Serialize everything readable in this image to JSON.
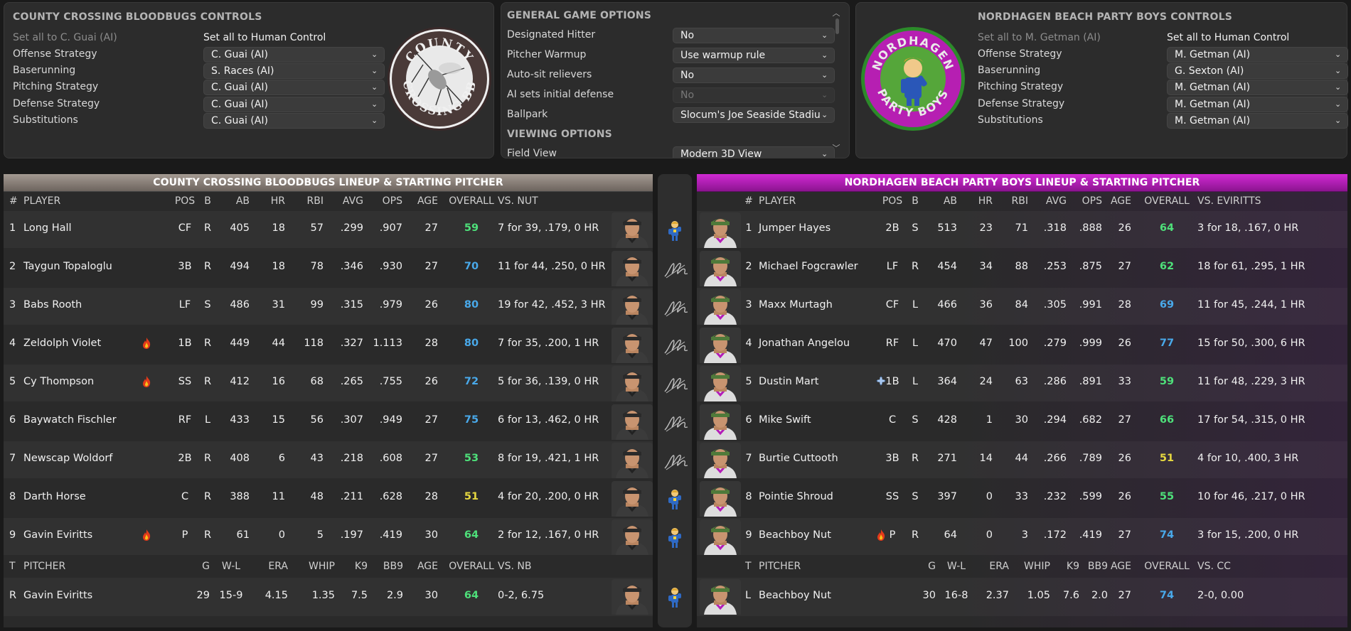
{
  "colors": {
    "away_accent": "#8a8078",
    "home_accent": "#c21bc4",
    "rating_green": "#4ee07a",
    "rating_blue": "#49a9ea",
    "rating_yellow": "#e6d840"
  },
  "away_controls": {
    "title": "COUNTY CROSSING BLOODBUGS CONTROLS",
    "set_ai": "Set all to C. Guai (AI)",
    "set_human": "Set all to Human Control",
    "rows": [
      {
        "label": "Offense Strategy",
        "value": "C. Guai (AI)"
      },
      {
        "label": "Baserunning",
        "value": "S. Races (AI)"
      },
      {
        "label": "Pitching Strategy",
        "value": "C. Guai (AI)"
      },
      {
        "label": "Defense Strategy",
        "value": "C. Guai (AI)"
      },
      {
        "label": "Substitutions",
        "value": "C. Guai (AI)"
      }
    ],
    "logo": {
      "top": "COUNTY",
      "bottom": "CROSSING BB"
    }
  },
  "options": {
    "title": "GENERAL GAME OPTIONS",
    "rows": [
      {
        "label": "Designated Hitter",
        "value": "No"
      },
      {
        "label": "Pitcher Warmup",
        "value": "Use warmup rule"
      },
      {
        "label": "Auto-sit relievers",
        "value": "No"
      },
      {
        "label": "AI sets initial defense",
        "value": "No"
      },
      {
        "label": "Ballpark",
        "value": "Slocum's Joe Seaside Stadiu"
      }
    ],
    "viewing_title": "VIEWING OPTIONS",
    "field_view_label": "Field View",
    "field_view_value": "Modern 3D View"
  },
  "home_controls": {
    "title": "NORDHAGEN BEACH PARTY BOYS CONTROLS",
    "set_ai": "Set all to M. Getman (AI)",
    "set_human": "Set all to Human Control",
    "rows": [
      {
        "label": "Offense Strategy",
        "value": "M. Getman (AI)"
      },
      {
        "label": "Baserunning",
        "value": "G. Sexton (AI)"
      },
      {
        "label": "Pitching Strategy",
        "value": "M. Getman (AI)"
      },
      {
        "label": "Defense Strategy",
        "value": "M. Getman (AI)"
      },
      {
        "label": "Substitutions",
        "value": "M. Getman (AI)"
      }
    ],
    "logo": {
      "top": "NORDHAGEN",
      "bottom": "PARTY BOYS"
    }
  },
  "away_lineup": {
    "title": "COUNTY CROSSING BLOODBUGS LINEUP & STARTING PITCHER",
    "headers": {
      "num": "#",
      "player": "PLAYER",
      "pos": "POS",
      "b": "B",
      "ab": "AB",
      "hr": "HR",
      "rbi": "RBI",
      "avg": "AVG",
      "ops": "OPS",
      "age": "AGE",
      "overall": "OVERALL",
      "vs": "VS. NUT"
    },
    "players": [
      {
        "num": "1",
        "name": "Long Hall",
        "fire": false,
        "pos": "CF",
        "b": "R",
        "ab": "405",
        "hr": "18",
        "rbi": "57",
        "avg": ".299",
        "ops": ".907",
        "age": "27",
        "overall": "59",
        "vs": "7 for 39, .179, 0 HR",
        "rating": "green"
      },
      {
        "num": "2",
        "name": "Taygun Topaloglu",
        "fire": false,
        "pos": "3B",
        "b": "R",
        "ab": "494",
        "hr": "18",
        "rbi": "78",
        "avg": ".346",
        "ops": ".930",
        "age": "27",
        "overall": "70",
        "vs": "11 for 44, .250, 0 HR",
        "rating": "blue"
      },
      {
        "num": "3",
        "name": "Babs Rooth",
        "fire": false,
        "pos": "LF",
        "b": "S",
        "ab": "486",
        "hr": "31",
        "rbi": "99",
        "avg": ".315",
        "ops": ".979",
        "age": "26",
        "overall": "80",
        "vs": "19 for 42, .452, 3 HR",
        "rating": "blue"
      },
      {
        "num": "4",
        "name": "Zeldolph Violet",
        "fire": true,
        "pos": "1B",
        "b": "R",
        "ab": "449",
        "hr": "44",
        "rbi": "118",
        "avg": ".327",
        "ops": "1.113",
        "age": "28",
        "overall": "80",
        "vs": "7 for 35, .200, 1 HR",
        "rating": "blue"
      },
      {
        "num": "5",
        "name": "Cy Thompson",
        "fire": true,
        "pos": "SS",
        "b": "R",
        "ab": "412",
        "hr": "16",
        "rbi": "68",
        "avg": ".265",
        "ops": ".755",
        "age": "26",
        "overall": "72",
        "vs": "5 for 36, .139, 0 HR",
        "rating": "blue"
      },
      {
        "num": "6",
        "name": "Baywatch Fischler",
        "fire": false,
        "pos": "RF",
        "b": "L",
        "ab": "433",
        "hr": "15",
        "rbi": "56",
        "avg": ".307",
        "ops": ".949",
        "age": "27",
        "overall": "75",
        "vs": "6 for 13, .462, 0 HR",
        "rating": "blue"
      },
      {
        "num": "7",
        "name": "Newscap Woldorf",
        "fire": false,
        "pos": "2B",
        "b": "R",
        "ab": "408",
        "hr": "6",
        "rbi": "43",
        "avg": ".218",
        "ops": ".608",
        "age": "27",
        "overall": "53",
        "vs": "8 for 19, .421, 1 HR",
        "rating": "green"
      },
      {
        "num": "8",
        "name": "Darth Horse",
        "fire": false,
        "pos": "C",
        "b": "R",
        "ab": "388",
        "hr": "11",
        "rbi": "48",
        "avg": ".211",
        "ops": ".628",
        "age": "28",
        "overall": "51",
        "vs": "4 for 20, .200, 0 HR",
        "rating": "yellow"
      },
      {
        "num": "9",
        "name": "Gavin Eviritts",
        "fire": true,
        "pos": "P",
        "b": "R",
        "ab": "61",
        "hr": "0",
        "rbi": "5",
        "avg": ".197",
        "ops": ".419",
        "age": "30",
        "overall": "64",
        "vs": "2 for 12, .167, 0 HR",
        "rating": "green"
      }
    ],
    "pheaders": {
      "t": "T",
      "pitcher": "PITCHER",
      "g": "G",
      "wl": "W-L",
      "era": "ERA",
      "whip": "WHIP",
      "k9": "K9",
      "bb9": "BB9",
      "age": "AGE",
      "overall": "OVERALL",
      "vs": "VS. NB"
    },
    "pitcher": {
      "t": "R",
      "name": "Gavin Eviritts",
      "g": "29",
      "wl": "15-9",
      "era": "4.15",
      "whip": "1.35",
      "k9": "7.5",
      "bb9": "2.9",
      "age": "30",
      "overall": "64",
      "vs": "0-2, 6.75",
      "rating": "green"
    }
  },
  "home_lineup": {
    "title": "NORDHAGEN BEACH PARTY BOYS LINEUP & STARTING PITCHER",
    "headers": {
      "num": "#",
      "player": "PLAYER",
      "pos": "POS",
      "b": "B",
      "ab": "AB",
      "hr": "HR",
      "rbi": "RBI",
      "avg": "AVG",
      "ops": "OPS",
      "age": "AGE",
      "overall": "OVERALL",
      "vs": "VS. EVIRITTS"
    },
    "players": [
      {
        "num": "1",
        "name": "Jumper Hayes",
        "icon": "",
        "pos": "2B",
        "b": "S",
        "ab": "513",
        "hr": "23",
        "rbi": "71",
        "avg": ".318",
        "ops": ".888",
        "age": "26",
        "overall": "64",
        "vs": "3 for 18, .167, 0 HR",
        "rating": "green"
      },
      {
        "num": "2",
        "name": "Michael Fogcrawler",
        "icon": "",
        "pos": "LF",
        "b": "R",
        "ab": "454",
        "hr": "34",
        "rbi": "88",
        "avg": ".253",
        "ops": ".875",
        "age": "27",
        "overall": "62",
        "vs": "18 for 61, .295, 1 HR",
        "rating": "green"
      },
      {
        "num": "3",
        "name": "Maxx Murtagh",
        "icon": "",
        "pos": "CF",
        "b": "L",
        "ab": "466",
        "hr": "36",
        "rbi": "84",
        "avg": ".305",
        "ops": ".991",
        "age": "28",
        "overall": "69",
        "vs": "11 for 45, .244, 1 HR",
        "rating": "blue"
      },
      {
        "num": "4",
        "name": "Jonathan Angelou",
        "icon": "",
        "pos": "RF",
        "b": "L",
        "ab": "470",
        "hr": "47",
        "rbi": "100",
        "avg": ".279",
        "ops": ".999",
        "age": "26",
        "overall": "77",
        "vs": "15 for 50, .300, 6 HR",
        "rating": "blue"
      },
      {
        "num": "5",
        "name": "Dustin Mart",
        "icon": "plus",
        "pos": "1B",
        "b": "L",
        "ab": "364",
        "hr": "24",
        "rbi": "63",
        "avg": ".286",
        "ops": ".891",
        "age": "33",
        "overall": "59",
        "vs": "11 for 48, .229, 3 HR",
        "rating": "green"
      },
      {
        "num": "6",
        "name": "Mike Swift",
        "icon": "",
        "pos": "C",
        "b": "S",
        "ab": "428",
        "hr": "1",
        "rbi": "30",
        "avg": ".294",
        "ops": ".682",
        "age": "27",
        "overall": "66",
        "vs": "17 for 54, .315, 0 HR",
        "rating": "green"
      },
      {
        "num": "7",
        "name": "Burtie Cuttooth",
        "icon": "",
        "pos": "3B",
        "b": "R",
        "ab": "271",
        "hr": "14",
        "rbi": "44",
        "avg": ".266",
        "ops": ".789",
        "age": "26",
        "overall": "51",
        "vs": "4 for 10, .400, 3 HR",
        "rating": "yellow"
      },
      {
        "num": "8",
        "name": "Pointie Shroud",
        "icon": "",
        "pos": "SS",
        "b": "S",
        "ab": "397",
        "hr": "0",
        "rbi": "33",
        "avg": ".232",
        "ops": ".599",
        "age": "26",
        "overall": "55",
        "vs": "10 for 46, .217, 0 HR",
        "rating": "green"
      },
      {
        "num": "9",
        "name": "Beachboy Nut",
        "icon": "fire",
        "pos": "P",
        "b": "R",
        "ab": "64",
        "hr": "0",
        "rbi": "3",
        "avg": ".172",
        "ops": ".419",
        "age": "27",
        "overall": "74",
        "vs": "3 for 15, .200, 0 HR",
        "rating": "blue"
      }
    ],
    "pheaders": {
      "t": "T",
      "pitcher": "PITCHER",
      "g": "G",
      "wl": "W-L",
      "era": "ERA",
      "whip": "WHIP",
      "k9": "K9",
      "bb9": "BB9",
      "age": "AGE",
      "overall": "OVERALL",
      "vs": "VS. CC"
    },
    "pitcher": {
      "t": "L",
      "name": "Beachboy Nut",
      "g": "30",
      "wl": "16-8",
      "era": "2.37",
      "whip": "1.05",
      "k9": "7.6",
      "bb9": "2.0",
      "age": "27",
      "overall": "74",
      "vs": "2-0, 0.00",
      "rating": "blue"
    }
  },
  "middle_icons": [
    "trophy-icon",
    "signature-icon",
    "signature-icon",
    "signature-icon",
    "signature-icon",
    "signature-icon",
    "signature-icon",
    "trophy-icon",
    "trophy-icon",
    "trophy-icon"
  ]
}
